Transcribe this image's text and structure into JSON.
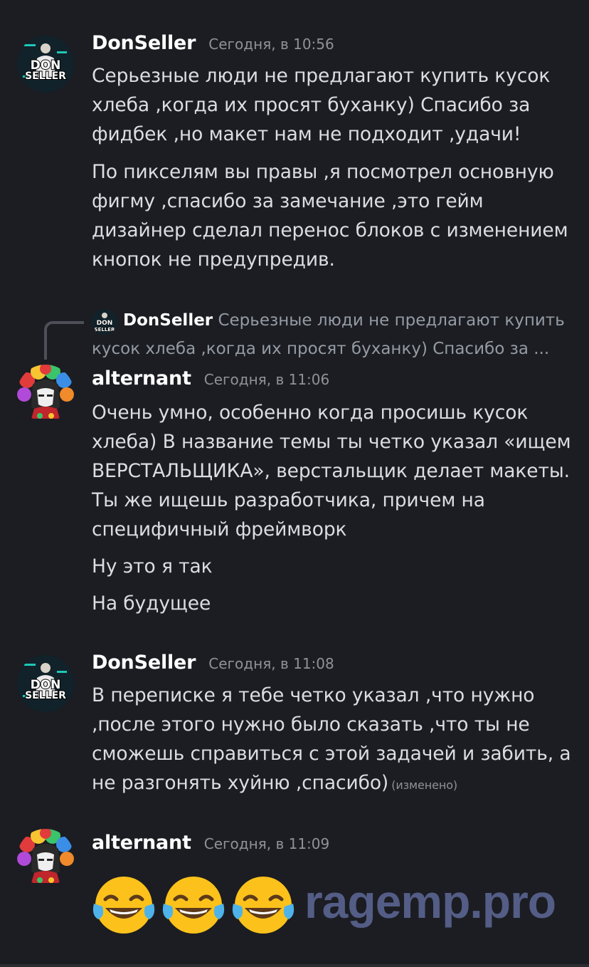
{
  "messages": [
    {
      "username": "DonSeller",
      "timestamp": "Сегодня, в 10:56",
      "avatar_text": [
        "DON",
        "SELLER"
      ],
      "paragraphs": [
        "Серьезные люди не предлагают купить кусок хлеба ,когда их просят буханку) Спасибо за фидбек ,но макет нам не подходит ,удачи!",
        "По пикселям вы правы ,я посмотрел основную фигму ,спасибо за замечание  ,это гейм дизайнер сделал перенос блоков с изменением кнопок не предупредив."
      ]
    },
    {
      "reply": {
        "username": "DonSeller",
        "text": "Серьезные люди не предлагают купить кусок хлеба ,когда их просят буханку) Спасибо за ..."
      },
      "username": "alternant",
      "timestamp": "Сегодня, в 11:06",
      "paragraphs": [
        "Очень умно, особенно когда просишь кусок хлеба) В название темы ты четко указал «ищем ВЕРСТАЛЬЩИКА», верстальщик делает макеты. Ты же ищешь разработчика, причем на специфичный фреймворк",
        "Ну это я так",
        "На будущее"
      ]
    },
    {
      "username": "DonSeller",
      "timestamp": "Сегодня, в 11:08",
      "avatar_text": [
        "DON",
        "SELLER"
      ],
      "text": "В переписке я тебе четко указал ,что нужно ,после этого нужно было сказать ,что ты не сможешь справиться с этой задачей и забить, а не разгонять хуйню ,спасибо)",
      "edited": "(изменено)"
    },
    {
      "username": "alternant",
      "timestamp": "Сегодня, в 11:09",
      "emojis": [
        "joy-emoji",
        "joy-emoji",
        "joy-emoji"
      ]
    }
  ],
  "watermark": "ragemp.pro",
  "colors": {
    "background": "#1c1d22",
    "text": "#dbdee1",
    "muted": "#8e9297",
    "username": "#ffffff"
  }
}
